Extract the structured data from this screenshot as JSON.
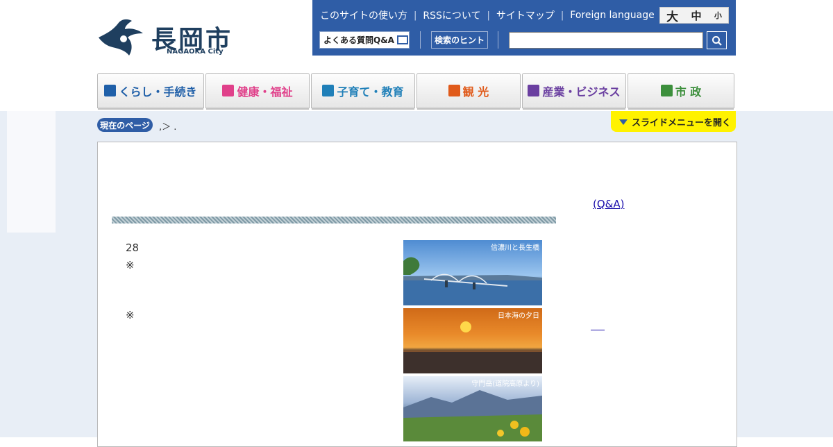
{
  "site": {
    "name": "長岡市",
    "name_en": "NAGAOKA City"
  },
  "utility": {
    "links": [
      "このサイトの使い方",
      "RSSについて",
      "サイトマップ",
      "Foreign language"
    ],
    "font_size": {
      "large": "大",
      "medium": "中",
      "small": "小"
    },
    "faq_label": "よくある質問Q&A",
    "hint_label": "検索のヒント",
    "search_placeholder": "",
    "search_icon": "search-icon"
  },
  "nav": [
    {
      "label": "くらし・手続き",
      "color": "#1f5fa8",
      "icon": "house-icon"
    },
    {
      "label": "健康・福祉",
      "color": "#e0408a",
      "icon": "ribbon-icon"
    },
    {
      "label": "子育て・教育",
      "color": "#1f7fb8",
      "icon": "child-icon"
    },
    {
      "label": "観 光",
      "color": "#e05a1a",
      "icon": "sightseeing-icon"
    },
    {
      "label": "産業・ビジネス",
      "color": "#6a3fa0",
      "icon": "industry-icon"
    },
    {
      "label": "市 政",
      "color": "#3c8f3c",
      "icon": "cityhall-icon"
    }
  ],
  "breadcrumb": {
    "badge": "現在のページ",
    "text": ",＞ ."
  },
  "slide_menu": "スライドメニューを開く",
  "content": {
    "faq_link": "(Q&A)",
    "number": "28",
    "note1": "※",
    "note2": "※",
    "photos": [
      {
        "caption": "信濃川と長生橋"
      },
      {
        "caption": "日本海の夕日"
      },
      {
        "caption": "守門岳(道院高原より)"
      }
    ]
  },
  "colors": {
    "brand": "#2f5da6",
    "slide_button": "#fff200",
    "background_band": "#e8eef6"
  }
}
